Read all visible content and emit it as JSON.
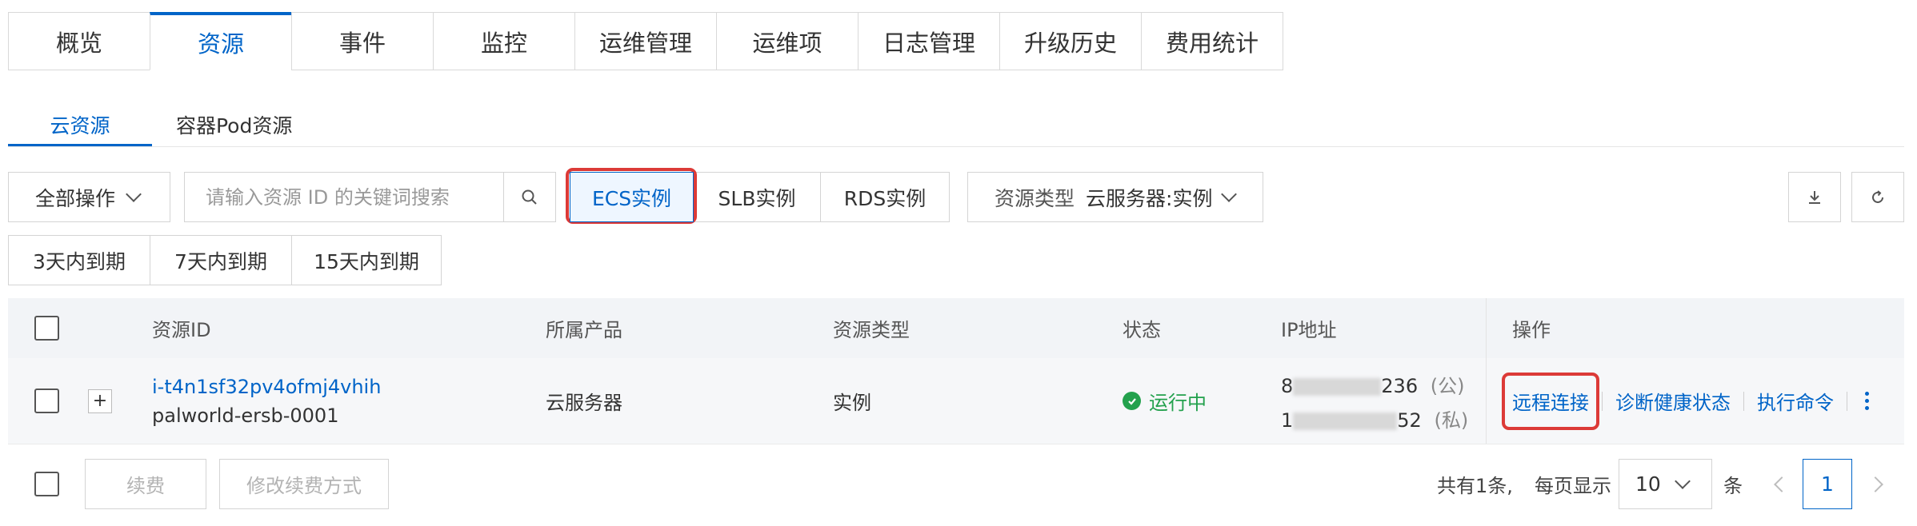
{
  "top_tabs": [
    "概览",
    "资源",
    "事件",
    "监控",
    "运维管理",
    "运维项",
    "日志管理",
    "升级历史",
    "费用统计"
  ],
  "sub_tabs": [
    "云资源",
    "容器Pod资源"
  ],
  "toolbar": {
    "bulk_label": "全部操作",
    "search_placeholder": "请输入资源 ID 的关键词搜索",
    "instance_types": [
      "ECS实例",
      "SLB实例",
      "RDS实例"
    ],
    "resource_type_label": "资源类型",
    "resource_type_value": "云服务器:实例",
    "expiry_filters": [
      "3天内到期",
      "7天内到期",
      "15天内到期"
    ]
  },
  "table": {
    "headers": [
      "资源ID",
      "所属产品",
      "资源类型",
      "状态",
      "IP地址",
      "操作"
    ],
    "rows": [
      {
        "resource_id": "i-t4n1sf32pv4ofmj4vhih",
        "resource_name": "palworld-ersb-0001",
        "product": "云服务器",
        "type": "实例",
        "status": "运行中",
        "ip_public_prefix": "8",
        "ip_public_suffix": "236",
        "ip_public_tag": "(公)",
        "ip_private_prefix": "1",
        "ip_private_suffix": "52",
        "ip_private_tag": "(私)",
        "actions": [
          "远程连接",
          "诊断健康状态",
          "执行命令"
        ]
      }
    ]
  },
  "footer": {
    "renew": "续费",
    "change_renew": "修改续费方式",
    "total": "共有1条,",
    "per_page": "每页显示",
    "page_size": "10",
    "unit": "条",
    "current_page": "1"
  },
  "colors": {
    "accent": "#0064c8",
    "highlight": "#dc3a37",
    "running": "#23a14d"
  }
}
